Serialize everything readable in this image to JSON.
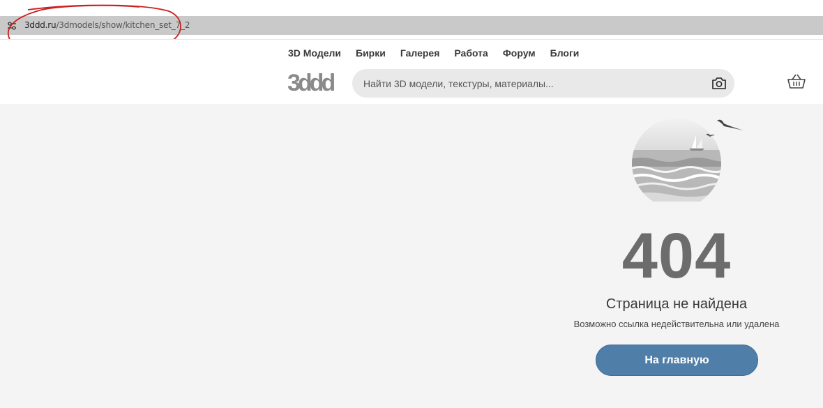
{
  "browser": {
    "url_domain": "3ddd.ru",
    "url_path": "/3dmodels/show/kitchen_set_7_2",
    "site_info_icon": "tune-icon"
  },
  "header": {
    "nav": [
      {
        "label": "3D Модели"
      },
      {
        "label": "Бирки"
      },
      {
        "label": "Галерея"
      },
      {
        "label": "Работа"
      },
      {
        "label": "Форум"
      },
      {
        "label": "Блоги"
      }
    ],
    "logo_text": "3ddd",
    "search": {
      "placeholder": "Найти 3D модели, текстуры, материалы...",
      "value": "",
      "camera_icon": "camera-icon"
    },
    "cart_icon": "basket-icon"
  },
  "error": {
    "code": "404",
    "title": "Страница не найдена",
    "subtitle": "Возможно ссылка недействительна или удалена",
    "home_button": "На главную"
  },
  "colors": {
    "button": "#4f7fa8",
    "annotation": "#cc1f1f",
    "code": "#6c6c6c",
    "background": "#f4f4f4"
  }
}
